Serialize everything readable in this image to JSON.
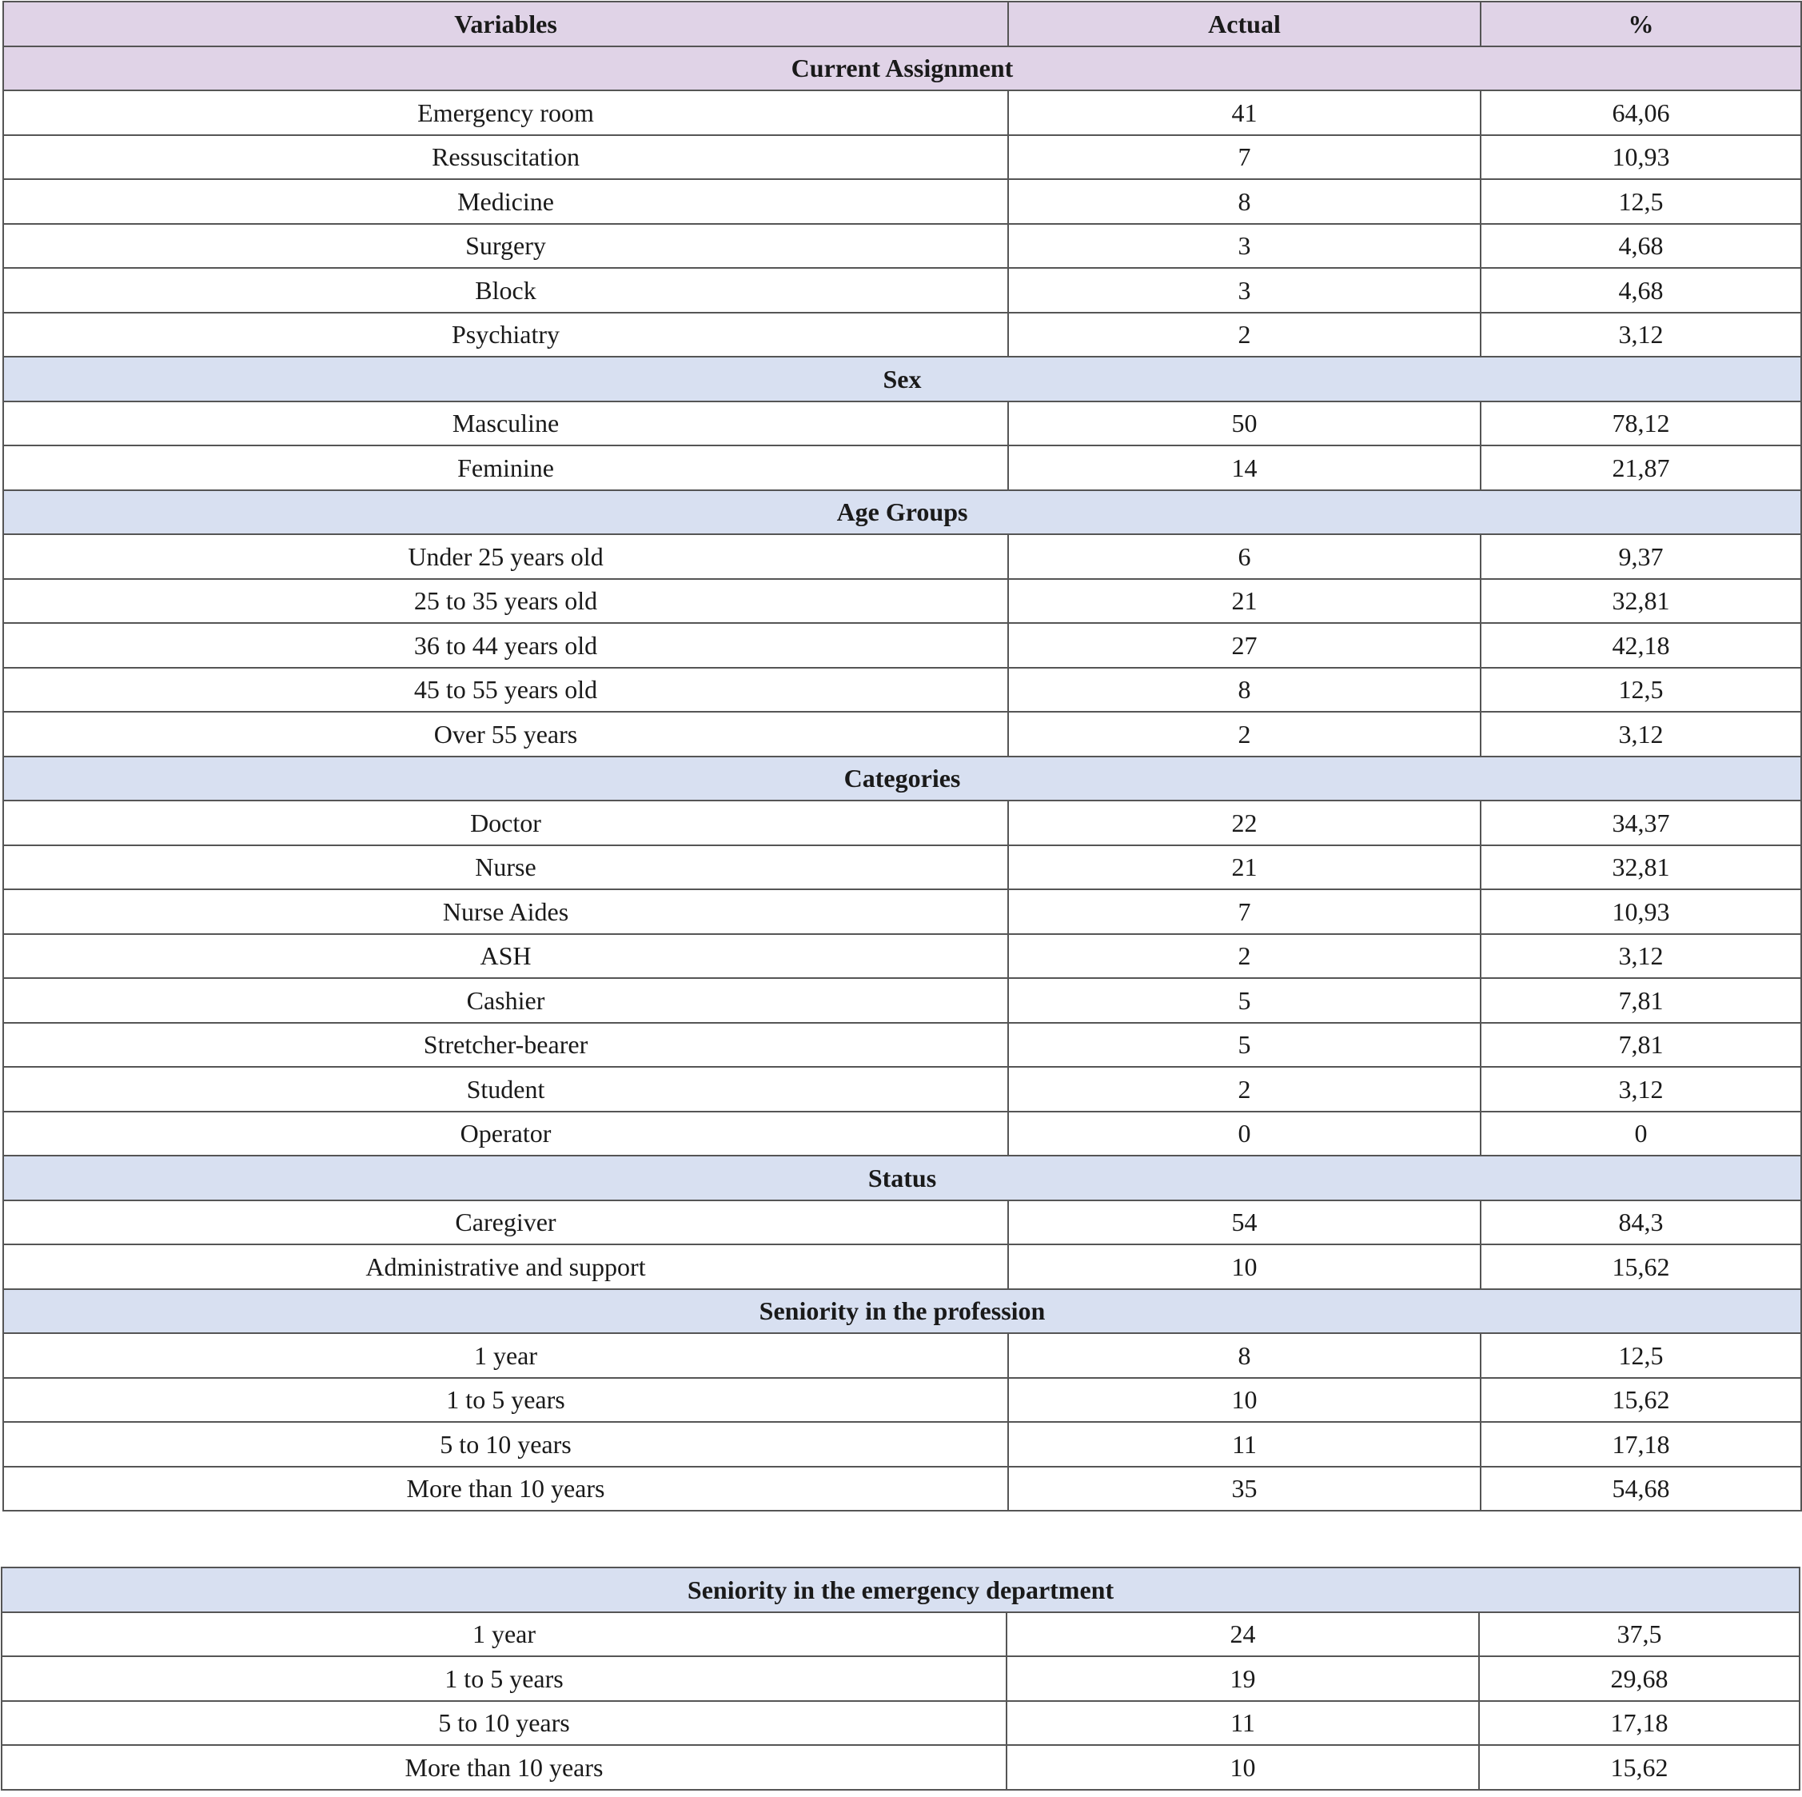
{
  "header": {
    "variables": "Variables",
    "actual": "Actual",
    "percent": "%"
  },
  "sections": [
    {
      "title": "Current Assignment",
      "rows": [
        {
          "label": "Emergency room",
          "actual": "41",
          "percent": "64,06"
        },
        {
          "label": "Ressuscitation",
          "actual": "7",
          "percent": "10,93"
        },
        {
          "label": "Medicine",
          "actual": "8",
          "percent": "12,5"
        },
        {
          "label": "Surgery",
          "actual": "3",
          "percent": "4,68"
        },
        {
          "label": "Block",
          "actual": "3",
          "percent": "4,68"
        },
        {
          "label": "Psychiatry",
          "actual": "2",
          "percent": "3,12"
        }
      ]
    },
    {
      "title": "Sex",
      "rows": [
        {
          "label": "Masculine",
          "actual": "50",
          "percent": "78,12"
        },
        {
          "label": "Feminine",
          "actual": "14",
          "percent": "21,87"
        }
      ]
    },
    {
      "title": "Age Groups",
      "rows": [
        {
          "label": "Under 25 years old",
          "actual": "6",
          "percent": "9,37"
        },
        {
          "label": "25 to 35 years old",
          "actual": "21",
          "percent": "32,81"
        },
        {
          "label": "36 to 44 years old",
          "actual": "27",
          "percent": "42,18"
        },
        {
          "label": "45 to 55 years old",
          "actual": "8",
          "percent": "12,5"
        },
        {
          "label": "Over 55 years",
          "actual": "2",
          "percent": "3,12"
        }
      ]
    },
    {
      "title": "Categories",
      "rows": [
        {
          "label": "Doctor",
          "actual": "22",
          "percent": "34,37"
        },
        {
          "label": "Nurse",
          "actual": "21",
          "percent": "32,81"
        },
        {
          "label": "Nurse Aides",
          "actual": "7",
          "percent": "10,93"
        },
        {
          "label": "ASH",
          "actual": "2",
          "percent": "3,12"
        },
        {
          "label": "Cashier",
          "actual": "5",
          "percent": "7,81"
        },
        {
          "label": "Stretcher-bearer",
          "actual": "5",
          "percent": "7,81"
        },
        {
          "label": "Student",
          "actual": "2",
          "percent": "3,12"
        },
        {
          "label": "Operator",
          "actual": "0",
          "percent": "0"
        }
      ]
    },
    {
      "title": "Status",
      "rows": [
        {
          "label": "Caregiver",
          "actual": "54",
          "percent": "84,3"
        },
        {
          "label": "Administrative and support",
          "actual": "10",
          "percent": "15,62"
        }
      ]
    },
    {
      "title": "Seniority in the profession",
      "rows": [
        {
          "label": "1 year",
          "actual": "8",
          "percent": "12,5"
        },
        {
          "label": "1 to 5 years",
          "actual": "10",
          "percent": "15,62"
        },
        {
          "label": "5 to 10 years",
          "actual": "11",
          "percent": "17,18"
        },
        {
          "label": "More than 10 years",
          "actual": "35",
          "percent": "54,68"
        }
      ]
    },
    {
      "title": "Seniority in the emergency department",
      "rows": [
        {
          "label": "1 year",
          "actual": "24",
          "percent": "37,5"
        },
        {
          "label": "1 to 5 years",
          "actual": "19",
          "percent": "29,68"
        },
        {
          "label": "5 to 10 years",
          "actual": "11",
          "percent": "17,18"
        },
        {
          "label": "More than 10 years",
          "actual": "10",
          "percent": "15,62"
        }
      ]
    }
  ]
}
